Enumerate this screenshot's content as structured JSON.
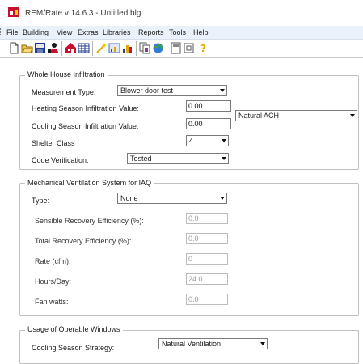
{
  "window": {
    "title": "REM/Rate v 14.6.3  - Untitled.blg"
  },
  "menu": [
    "File",
    "Building",
    "View",
    "Extras",
    "Libraries",
    "Reports",
    "Tools",
    "Help"
  ],
  "toolbar": {
    "buttons": [
      "new-file-icon",
      "open-folder-icon",
      "save-icon",
      "user-icon",
      "building-icon",
      "table-icon",
      "wand-icon",
      "report-icon",
      "chart-icon",
      "copy-pages-icon",
      "globe-icon",
      "calculator-icon",
      "box-icon",
      "help-icon"
    ]
  },
  "infiltration": {
    "title": "Whole House Infiltration",
    "measurement_type_label": "Measurement Type:",
    "measurement_type_value": "Blower door test",
    "heating_label": "Heating Season Infiltration Value:",
    "heating_value": "0.00",
    "cooling_label": "Cooling Season Infiltration Value:",
    "cooling_value": "0.00",
    "units_value": "Natural ACH",
    "shelter_label": "Shelter Class",
    "shelter_value": "4",
    "code_label": "Code Verification:",
    "code_value": "Tested"
  },
  "ventilation": {
    "title": "Mechanical Ventilation System for IAQ",
    "type_label": "Type:",
    "type_value": "None",
    "sensible_label": "Sensible Recovery Efficiency (%):",
    "sensible_value": "0.0",
    "total_label": "Total Recovery Efficiency (%):",
    "total_value": "0.0",
    "rate_label": "Rate (cfm):",
    "rate_value": "0",
    "hours_label": "Hours/Day:",
    "hours_value": "24.0",
    "fan_label": "Fan watts:",
    "fan_value": "0.0"
  },
  "windows": {
    "title": "Usage of Operable Windows",
    "cooling_strategy_label": "Cooling Season Strategy:",
    "cooling_strategy_value": "Natural Ventilation"
  },
  "colors": {
    "menubar_bg": "#eaf1fb",
    "group_border": "#bfbfbf",
    "disabled_text": "#9a9a9a"
  }
}
